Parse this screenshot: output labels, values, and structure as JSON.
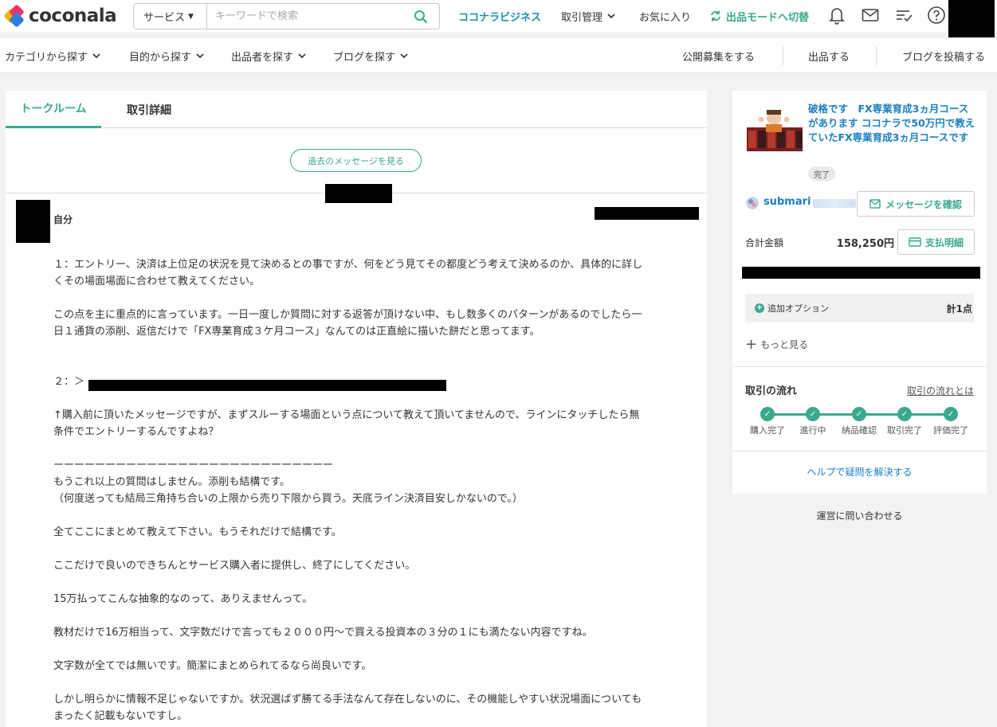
{
  "header": {
    "logo_text": "coconala",
    "search": {
      "category": "サービス",
      "placeholder": "キーワードで検索"
    },
    "nav": {
      "business": "ココナラビジネス",
      "transactions": "取引管理",
      "favorites": "お気に入り",
      "seller_mode": "出品モードへ切替"
    }
  },
  "subnav": {
    "left": [
      "カテゴリから探す",
      "目的から探す",
      "出品者を探す",
      "ブログを探す"
    ],
    "right": [
      "公開募集をする",
      "出品する",
      "ブログを投稿する"
    ]
  },
  "tabs": {
    "talkroom": "トークルーム",
    "details": "取引詳細"
  },
  "past_messages_button": "過去のメッセージを見る",
  "message": {
    "sender": "自分",
    "lines": [
      "１：エントリー、決済は上位足の状況を見て決めるとの事ですが、何をどう見てその都度どう考えて決めるのか、具体的に詳し",
      "くその場面場面に合わせて教えてください。",
      "",
      "この点を主に重点的に言っています。一日一度しか質問に対する返答が頂けない中、もし数多くのパターンがあるのでしたら一",
      "日１通貨の添削、返信だけで「FX専業育成３ケ月コース」なんてのは正直絵に描いた餅だと思ってます。",
      "",
      "",
      "２：＞",
      "",
      "↑購入前に頂いたメッセージですが、まずスルーする場面という点について教えて頂いてませんので、ラインにタッチしたら無",
      "条件でエントリーするんですよね？",
      "",
      "ーーーーーーーーーーーーーーーーーーーーーーーーーーー",
      "もうこれ以上の質問はしません。添削も結構です。",
      "（何度送っても結局三角持ち合いの上限から売り下限から買う。天底ライン決済目安しかないので。）",
      "",
      "全てここにまとめて教えて下さい。もうそれだけで結構です。",
      "",
      "ここだけで良いのできちんとサービス購入者に提供し、終了にしてください。",
      "",
      "15万払ってこんな抽象的なのって、ありえませんって。",
      "",
      "教材だけで16万相当って、文字数だけで言っても２０００円〜で買える投資本の３分の１にも満たない内容ですね。",
      "",
      "文字数が全てでは無いです。簡潔にまとめられてるなら尚良いです。",
      "",
      "しかし明らかに情報不足じゃないですか。状況選ばず勝てる手法なんて存在しないのに、その機能しやすい状況場面についても",
      "まったく記載もないですし。"
    ]
  },
  "sidebar": {
    "service_title": "破格です　FX専業育成3ヵ月コースがあります ココナラで50万円で教えていたFX専業育成3ヵ月コースです",
    "status": "完了",
    "seller_name": "submari",
    "message_button": "メッセージを確認",
    "total_label": "合計金額",
    "total_value": "158,250円",
    "payment_button": "支払明細",
    "option_label": "追加オプション",
    "option_count": "計1点",
    "more_label": "もっと見る",
    "flow_title": "取引の流れ",
    "flow_link": "取引の流れとは",
    "flow_steps": [
      "購入完了",
      "進行中",
      "納品確認",
      "取引完了",
      "評価完了"
    ],
    "help_link": "ヘルプで疑問を解決する"
  },
  "contact_link": "運営に問い合わせる",
  "colors": {
    "accent": "#3aa98f",
    "link": "#1a7fc4",
    "business": "#1a8fb0"
  }
}
